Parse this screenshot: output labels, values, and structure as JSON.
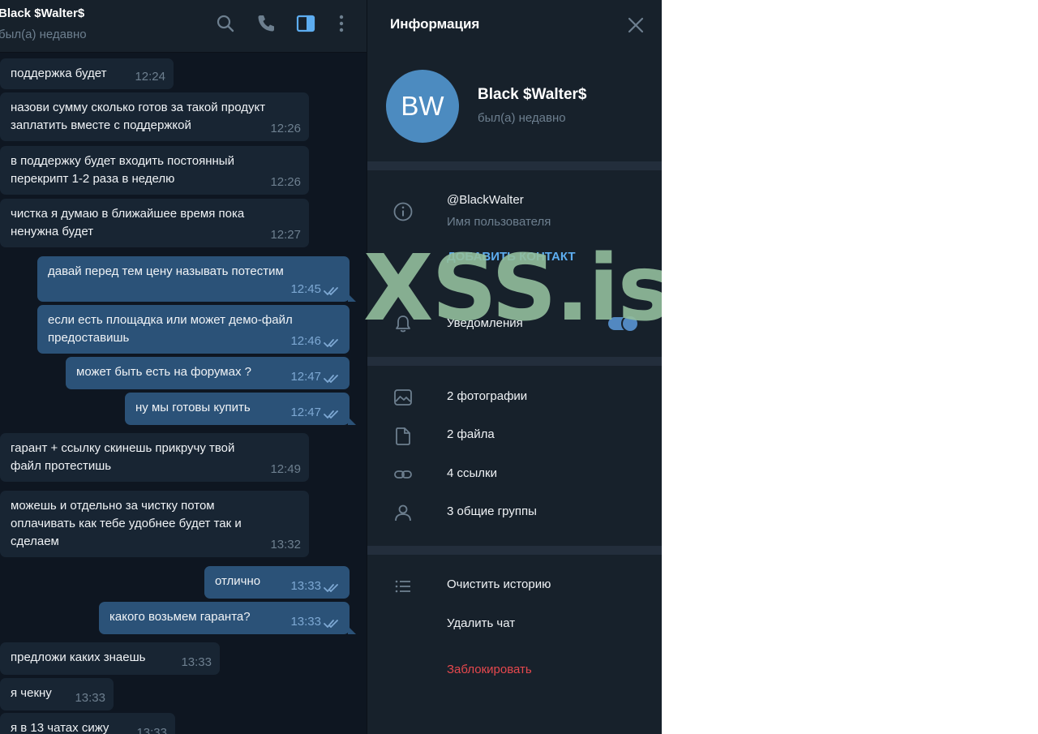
{
  "chat": {
    "title": "Black $Walter$",
    "status": "был(а) недавно",
    "messages": [
      {
        "dir": "in",
        "lines": [
          "поддержка будет"
        ],
        "time": "12:24"
      },
      {
        "dir": "in",
        "lines": [
          "назови сумму сколько готов за такой продукт",
          "заплатить вместе с поддержкой"
        ],
        "time": "12:26"
      },
      {
        "dir": "in",
        "lines": [
          "в поддержку будет входить постоянный",
          "перекрипт 1-2 раза в неделю"
        ],
        "time": "12:26"
      },
      {
        "dir": "in",
        "lines": [
          "чистка я думаю в ближайшее время пока",
          "ненужна будет"
        ],
        "time": "12:27"
      },
      {
        "dir": "out",
        "lines": [
          "давай перед тем цену называть потестим"
        ],
        "time": "12:45"
      },
      {
        "dir": "out",
        "lines": [
          "если есть площадка или может демо-файл",
          "предоставишь"
        ],
        "time": "12:46"
      },
      {
        "dir": "out",
        "lines": [
          "может быть есть на форумах ?"
        ],
        "time": "12:47"
      },
      {
        "dir": "out",
        "lines": [
          "ну мы готовы купить"
        ],
        "time": "12:47"
      },
      {
        "dir": "in",
        "lines": [
          "гарант + ссылку скинешь прикручу твой",
          "файл протестишь"
        ],
        "time": "12:49"
      },
      {
        "dir": "in",
        "lines": [
          "можешь и отдельно за чистку потом",
          "оплачивать как тебе удобнее будет так и",
          "сделаем"
        ],
        "time": "13:32"
      },
      {
        "dir": "out",
        "lines": [
          "отлично"
        ],
        "time": "13:33"
      },
      {
        "dir": "out",
        "lines": [
          "какого возьмем гаранта?"
        ],
        "time": "13:33"
      },
      {
        "dir": "in",
        "lines": [
          "предложи каких знаешь"
        ],
        "time": "13:33"
      },
      {
        "dir": "in",
        "lines": [
          "я чекну"
        ],
        "time": "13:33"
      },
      {
        "dir": "in",
        "lines": [
          "я в 13 чатах сижу"
        ],
        "time": "13:33"
      }
    ]
  },
  "info": {
    "title": "Информация",
    "avatar_initials": "BW",
    "avatar_color": "#4c8bc0",
    "name": "Black $Walter$",
    "status": "был(а) недавно",
    "username": "@BlackWalter",
    "username_label": "Имя пользователя",
    "add_contact": "ДОБАВИТЬ КОНТАКТ",
    "notifications": "Уведомления",
    "notifications_on": true,
    "media": {
      "photos": "2 фотографии",
      "files": "2 файла",
      "links": "4 ссылки",
      "groups": "3 общие группы"
    },
    "actions": {
      "clear_history": "Очистить историю",
      "delete_chat": "Удалить чат",
      "block": "Заблокировать"
    }
  },
  "watermark": "XSS.is",
  "colors": {
    "chat_bg": "#0e1621",
    "panel_bg": "#17212b",
    "bubble_in": "#182533",
    "bubble_out": "#2b5278",
    "accent": "#5dadf0",
    "danger": "#e5484d"
  }
}
